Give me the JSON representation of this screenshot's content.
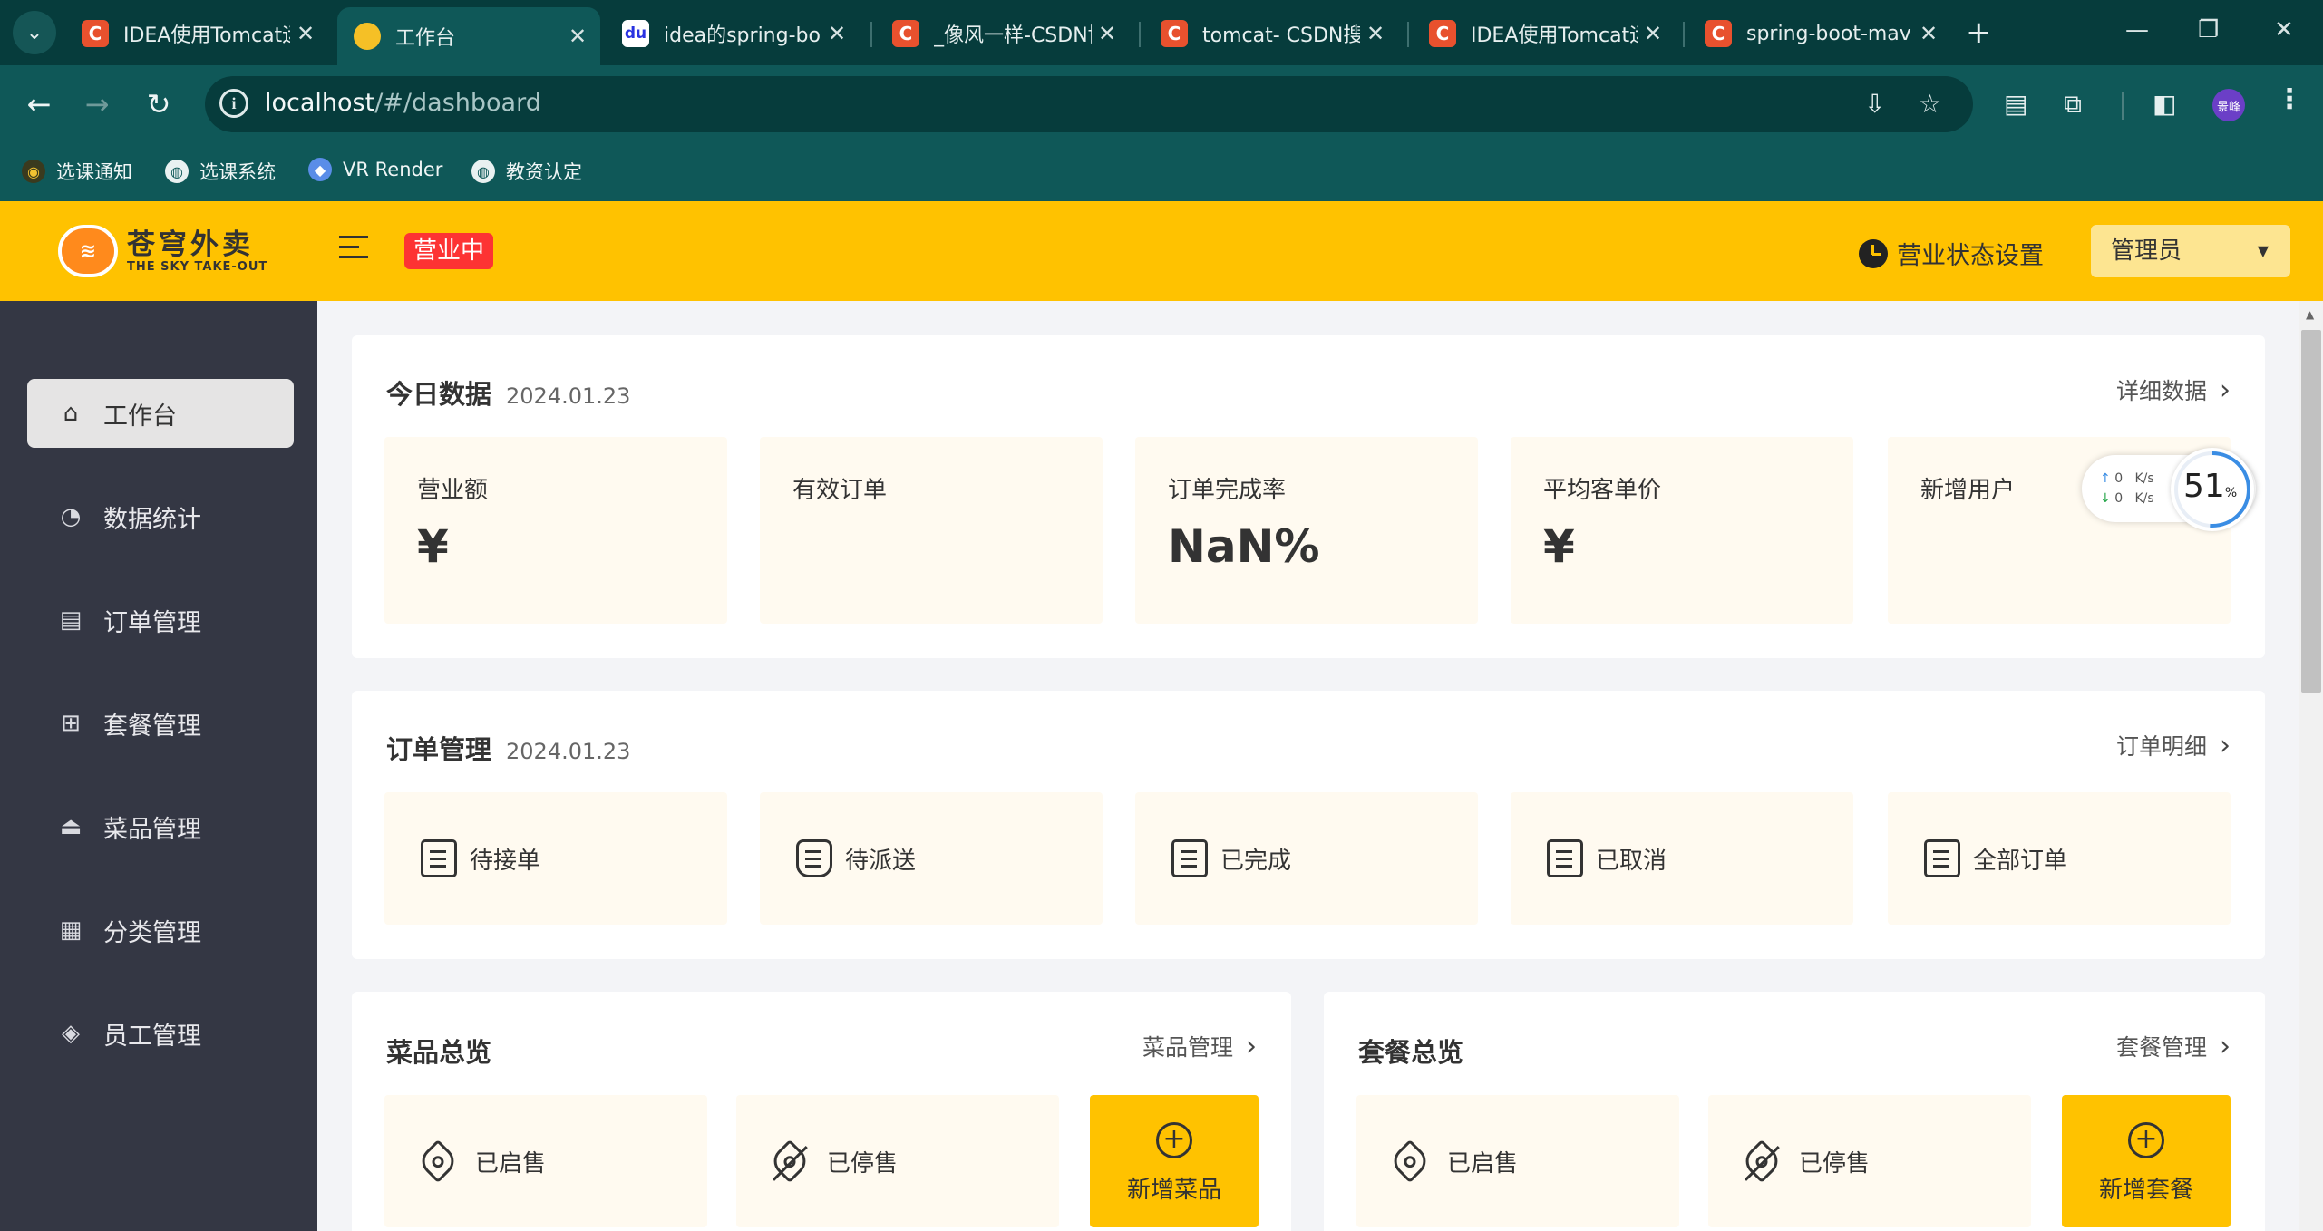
{
  "browser": {
    "tabs": [
      {
        "title": "IDEA使用Tomcat运",
        "favicon": "C"
      },
      {
        "title": "工作台",
        "favicon": "sky"
      },
      {
        "title": "idea的spring-boo",
        "favicon": "baidu"
      },
      {
        "title": "_像风一样-CSDN博",
        "favicon": "C"
      },
      {
        "title": "tomcat- CSDN搜",
        "favicon": "C"
      },
      {
        "title": "IDEA使用Tomcat运",
        "favicon": "C"
      },
      {
        "title": "spring-boot-mav",
        "favicon": "C"
      }
    ],
    "url_host": "localhost",
    "url_path": "/#/dashboard",
    "profile": "景峰",
    "bookmarks": [
      {
        "label": "选课通知"
      },
      {
        "label": "选课系统"
      },
      {
        "label": "VR Render"
      },
      {
        "label": "教资认定"
      }
    ]
  },
  "header": {
    "logo_cn": "苍穹外卖",
    "logo_en": "THE SKY TAKE-OUT",
    "status_badge": "营业中",
    "biz_setting": "营业状态设置",
    "admin": "管理员"
  },
  "sidebar": {
    "items": [
      {
        "label": "工作台",
        "icon": "home-icon"
      },
      {
        "label": "数据统计",
        "icon": "chart-icon"
      },
      {
        "label": "订单管理",
        "icon": "clipboard-icon"
      },
      {
        "label": "套餐管理",
        "icon": "gift-icon"
      },
      {
        "label": "菜品管理",
        "icon": "cloche-icon"
      },
      {
        "label": "分类管理",
        "icon": "grid-icon"
      },
      {
        "label": "员工管理",
        "icon": "tie-icon"
      }
    ]
  },
  "today": {
    "title": "今日数据",
    "date": "2024.01.23",
    "link": "详细数据",
    "stats": [
      {
        "label": "营业额",
        "value": "¥"
      },
      {
        "label": "有效订单",
        "value": ""
      },
      {
        "label": "订单完成率",
        "value": "NaN%"
      },
      {
        "label": "平均客单价",
        "value": "¥"
      },
      {
        "label": "新增用户",
        "value": ""
      }
    ]
  },
  "orders": {
    "title": "订单管理",
    "date": "2024.01.23",
    "link": "订单明细",
    "items": [
      {
        "label": "待接单"
      },
      {
        "label": "待派送"
      },
      {
        "label": "已完成"
      },
      {
        "label": "已取消"
      },
      {
        "label": "全部订单"
      }
    ]
  },
  "dishes": {
    "title": "菜品总览",
    "link": "菜品管理",
    "on_sale": "已启售",
    "off_sale": "已停售",
    "add": "新增菜品"
  },
  "setmeals": {
    "title": "套餐总览",
    "link": "套餐管理",
    "on_sale": "已启售",
    "off_sale": "已停售",
    "add": "新增套餐"
  },
  "widget": {
    "up": "0",
    "down": "0",
    "unit": "K/s",
    "percent": "51",
    "percent_sign": "%"
  }
}
